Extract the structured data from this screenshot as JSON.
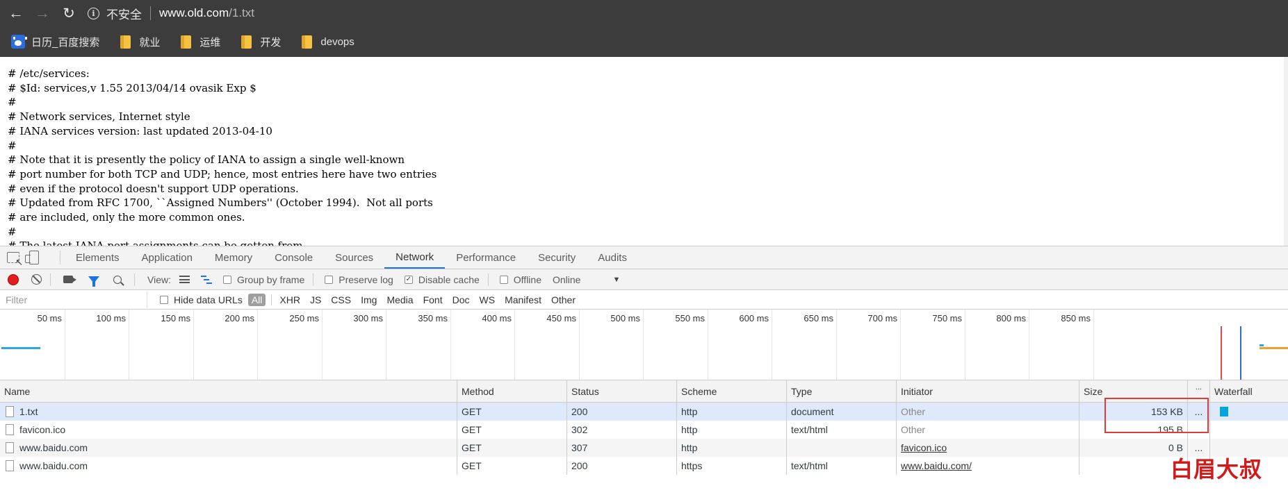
{
  "browser": {
    "security_label": "不安全",
    "url_host": "www.old.com",
    "url_path": "/1.txt"
  },
  "bookmarks": [
    {
      "label": "日历_百度搜索",
      "icon": "baidu-paw-icon"
    },
    {
      "label": "就业",
      "icon": "folder-icon"
    },
    {
      "label": "运维",
      "icon": "folder-icon"
    },
    {
      "label": "开发",
      "icon": "folder-icon"
    },
    {
      "label": "devops",
      "icon": "folder-icon"
    }
  ],
  "page": {
    "text": "# /etc/services:\n# $Id: services,v 1.55 2013/04/14 ovasik Exp $\n#\n# Network services, Internet style\n# IANA services version: last updated 2013-04-10\n#\n# Note that it is presently the policy of IANA to assign a single well-known\n# port number for both TCP and UDP; hence, most entries here have two entries\n# even if the protocol doesn't support UDP operations.\n# Updated from RFC 1700, ``Assigned Numbers'' (October 1994).  Not all ports\n# are included, only the more common ones.\n#\n# The latest IANA port assignments can be gotten from"
  },
  "devtools": {
    "tabs": [
      "Elements",
      "Application",
      "Memory",
      "Console",
      "Sources",
      "Network",
      "Performance",
      "Security",
      "Audits"
    ],
    "active_tab": "Network",
    "toolbar": {
      "view_label": "View:",
      "group_by_frame": "Group by frame",
      "preserve_log": "Preserve log",
      "disable_cache": "Disable cache",
      "disable_cache_checked": true,
      "offline": "Offline",
      "throttle": "Online"
    },
    "filter": {
      "placeholder": "Filter",
      "hide_data_urls": "Hide data URLs",
      "types": [
        "All",
        "XHR",
        "JS",
        "CSS",
        "Img",
        "Media",
        "Font",
        "Doc",
        "WS",
        "Manifest",
        "Other"
      ],
      "active_type": "All"
    },
    "overview": {
      "ticks": [
        "50 ms",
        "100 ms",
        "150 ms",
        "200 ms",
        "250 ms",
        "300 ms",
        "350 ms",
        "400 ms",
        "450 ms",
        "500 ms",
        "550 ms",
        "600 ms",
        "650 ms",
        "700 ms",
        "750 ms",
        "800 ms",
        "850 ms"
      ]
    },
    "table": {
      "columns": [
        "Name",
        "Method",
        "Status",
        "Scheme",
        "Type",
        "Initiator",
        "Size",
        "...",
        "Waterfall"
      ],
      "rows": [
        {
          "name": "1.txt",
          "method": "GET",
          "status": "200",
          "scheme": "http",
          "type": "document",
          "initiator": "Other",
          "size": "153 KB",
          "more": "..."
        },
        {
          "name": "favicon.ico",
          "method": "GET",
          "status": "302",
          "scheme": "http",
          "type": "text/html",
          "initiator": "Other",
          "size": "195 B",
          "more": "..."
        },
        {
          "name": "www.baidu.com",
          "method": "GET",
          "status": "307",
          "scheme": "http",
          "type": "",
          "initiator": "favicon.ico",
          "size": "0 B",
          "more": "..."
        },
        {
          "name": "www.baidu.com",
          "method": "GET",
          "status": "200",
          "scheme": "https",
          "type": "text/html",
          "initiator": "www.baidu.com/",
          "size": "",
          "more": ""
        }
      ]
    }
  },
  "watermark": "白眉大叔",
  "colors": {
    "accent": "#1a73e8",
    "record": "#e41c1c",
    "highlight": "#e53935",
    "waterfall_bar": "#00a5e0"
  }
}
